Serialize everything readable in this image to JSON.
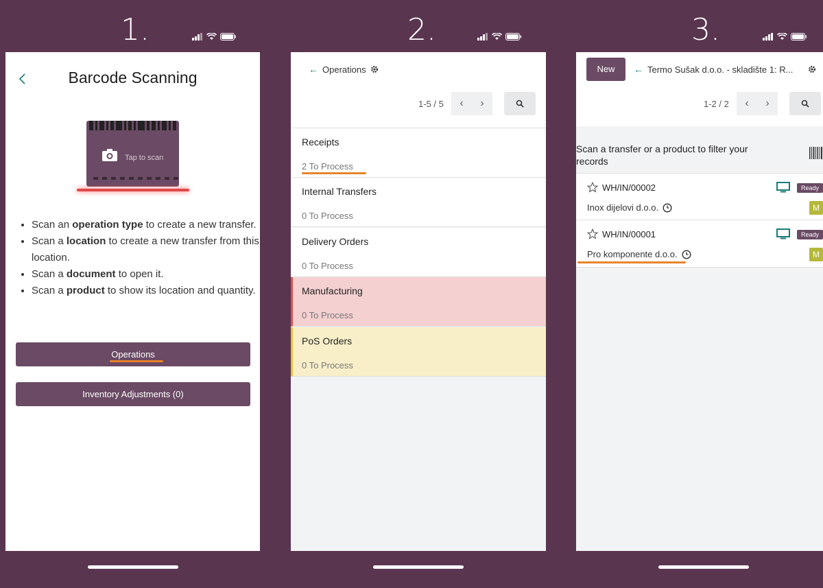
{
  "colors": {
    "frame": "#5a3550",
    "primary_button": "#6a4a64",
    "accent_teal": "#1a7a7a",
    "highlight_underline": "#e8842a",
    "manufacturing_bg": "#f5d0d0",
    "manufacturing_border": "#d9534f",
    "pos_bg": "#f8efc8",
    "pos_border": "#e5c33c",
    "avatar": "#b5b83a"
  },
  "step1": {
    "number": "1.",
    "title": "Barcode Scanning",
    "tap_to_scan": "Tap to scan",
    "instructions": [
      {
        "pre": "Scan an ",
        "bold": "operation type",
        "post": " to create a new transfer."
      },
      {
        "pre": "Scan a ",
        "bold": "location",
        "post": " to create a new transfer from this location."
      },
      {
        "pre": "Scan a ",
        "bold": "document",
        "post": " to open it."
      },
      {
        "pre": "Scan a ",
        "bold": "product",
        "post": " to show its location and quantity."
      }
    ],
    "operations_button": "Operations",
    "inventory_button": "Inventory Adjustments (0)"
  },
  "step2": {
    "number": "2.",
    "breadcrumb": "Operations",
    "pager": "1-5 / 5",
    "operations": [
      {
        "name": "Receipts",
        "count": "2 To Process"
      },
      {
        "name": "Internal Transfers",
        "count": "0 To Process"
      },
      {
        "name": "Delivery Orders",
        "count": "0 To Process"
      },
      {
        "name": "Manufacturing",
        "count": "0 To Process"
      },
      {
        "name": "PoS Orders",
        "count": "0 To Process"
      }
    ]
  },
  "step3": {
    "number": "3.",
    "new_button": "New",
    "breadcrumb": "Termo Sušak d.o.o. - skladište 1: R...",
    "pager": "1-2 / 2",
    "filter_hint": "Scan a transfer or a product to filter your records",
    "records": [
      {
        "reference": "WH/IN/00002",
        "partner": "Inox dijelovi d.o.o.",
        "status": "Ready",
        "avatar": "M"
      },
      {
        "reference": "WH/IN/00001",
        "partner": "Pro komponente d.o.o.",
        "status": "Ready",
        "avatar": "M"
      }
    ]
  },
  "icons": [
    "signal-icon",
    "wifi-icon",
    "battery-icon",
    "back-chevron-icon",
    "camera-icon",
    "back-arrow-icon",
    "gear-icon",
    "chevron-left-icon",
    "chevron-right-icon",
    "search-icon",
    "star-icon",
    "monitor-icon",
    "clock-icon",
    "barcode-icon"
  ]
}
